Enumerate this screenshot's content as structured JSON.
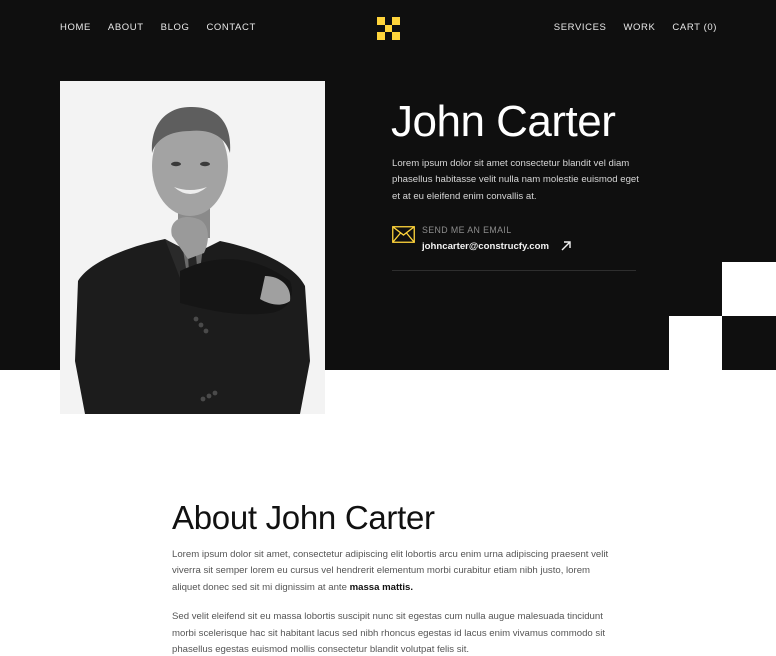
{
  "nav": {
    "left": [
      {
        "label": "HOME"
      },
      {
        "label": "ABOUT"
      },
      {
        "label": "BLOG"
      },
      {
        "label": "CONTACT"
      }
    ],
    "right": [
      {
        "label": "SERVICES"
      },
      {
        "label": "WORK"
      },
      {
        "label": "CART (0)"
      }
    ],
    "logo_icon": "checker-x-logo",
    "logo_color": "#ffd43b"
  },
  "hero": {
    "title": "John Carter",
    "description": "Lorem ipsum dolor sit amet consectetur blandit vel diam phasellus habitasse velit nulla nam molestie euismod eget et at eu eleifend enim convallis at.",
    "photo_alt": "Portrait of John Carter",
    "email": {
      "label": "SEND ME AN EMAIL",
      "address": "johncarter@construcfy.com",
      "icon": "envelope-icon",
      "link_icon": "arrow-up-right-icon"
    },
    "background_color": "#0f0f0f",
    "accent_color": "#ffd43b"
  },
  "about": {
    "title": "About John Carter",
    "paragraph1": "Lorem ipsum dolor sit amet, consectetur adipiscing elit lobortis arcu enim urna adipiscing praesent velit viverra sit semper lorem eu cursus vel hendrerit elementum morbi curabitur etiam nibh justo, lorem aliquet donec sed sit mi dignissim at ante ",
    "paragraph1_bold": "massa mattis.",
    "paragraph2": "Sed velit eleifend sit eu massa lobortis suscipit nunc sit egestas cum nulla augue malesuada tincidunt morbi scelerisque hac sit habitant lacus sed nibh rhoncus egestas id lacus enim vivamus commodo sit phasellus egestas euismod mollis consectetur blandit volutpat felis sit."
  }
}
